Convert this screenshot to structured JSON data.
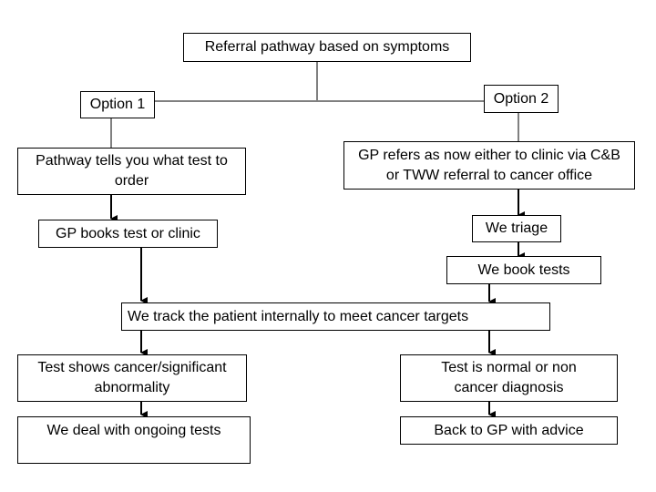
{
  "diagram": {
    "root": {
      "label": "Referral pathway based on symptoms"
    },
    "option1": {
      "label": "Option 1",
      "steps": [
        "Pathway tells you what test to order",
        "GP books test or clinic"
      ]
    },
    "option2": {
      "label": "Option 2",
      "steps": [
        "GP refers as now either to clinic via C&B or TWW referral to cancer office",
        "We triage",
        "We book tests"
      ]
    },
    "merge": {
      "label": "We track the patient internally to meet cancer targets"
    },
    "outcome_cancer": {
      "label": "Test shows cancer/significant abnormality",
      "next": "We deal with ongoing tests"
    },
    "outcome_normal": {
      "label": "Test is normal or non cancer diagnosis",
      "next": "Back to GP with advice"
    }
  }
}
